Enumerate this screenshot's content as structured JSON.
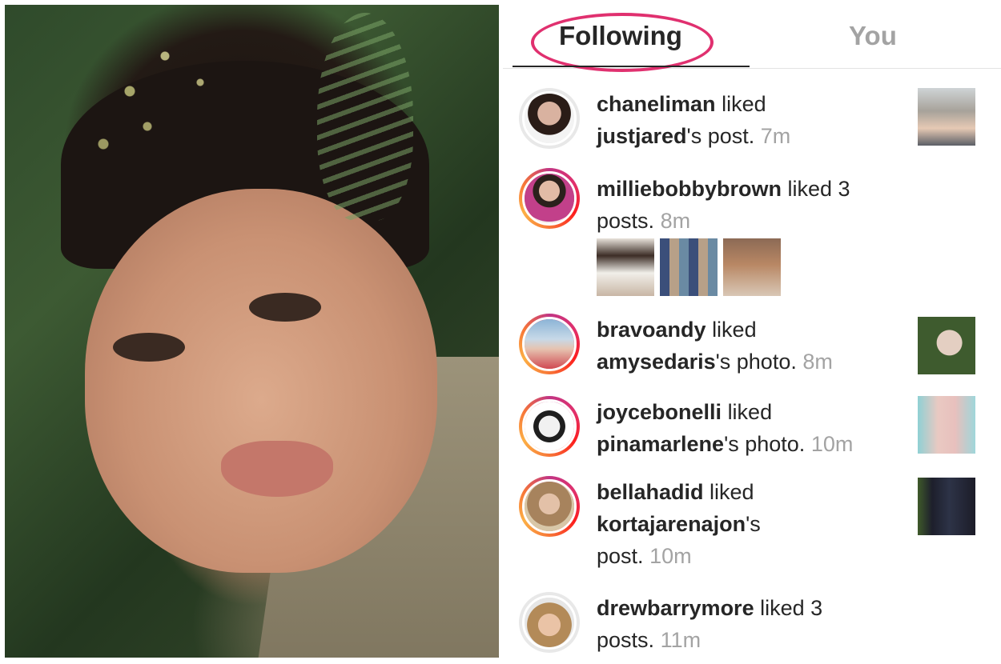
{
  "tabs": {
    "following": "Following",
    "you": "You"
  },
  "colors": {
    "highlight": "#e0306f",
    "text": "#262626",
    "muted": "#a3a3a3"
  },
  "activity": [
    {
      "user": "chaneliman",
      "verb": "liked",
      "target": "justjared",
      "suffix": "'s post.",
      "time": "7m"
    },
    {
      "user": "milliebobbybrown",
      "verb": "liked 3",
      "target": "",
      "suffix": "posts.",
      "time": "8m"
    },
    {
      "user": "bravoandy",
      "verb": "liked",
      "target": "amysedaris",
      "suffix": "'s photo.",
      "time": "8m"
    },
    {
      "user": "joycebonelli",
      "verb": "liked",
      "target": "pinamarlene",
      "suffix": "'s photo.",
      "time": "10m"
    },
    {
      "user": "bellahadid",
      "verb": "liked",
      "target": "kortajarenajon",
      "suffix": "'s",
      "suffix2": "post.",
      "time": "10m"
    },
    {
      "user": "drewbarrymore",
      "verb": "liked 3",
      "target": "",
      "suffix": "posts.",
      "time": "11m"
    }
  ]
}
